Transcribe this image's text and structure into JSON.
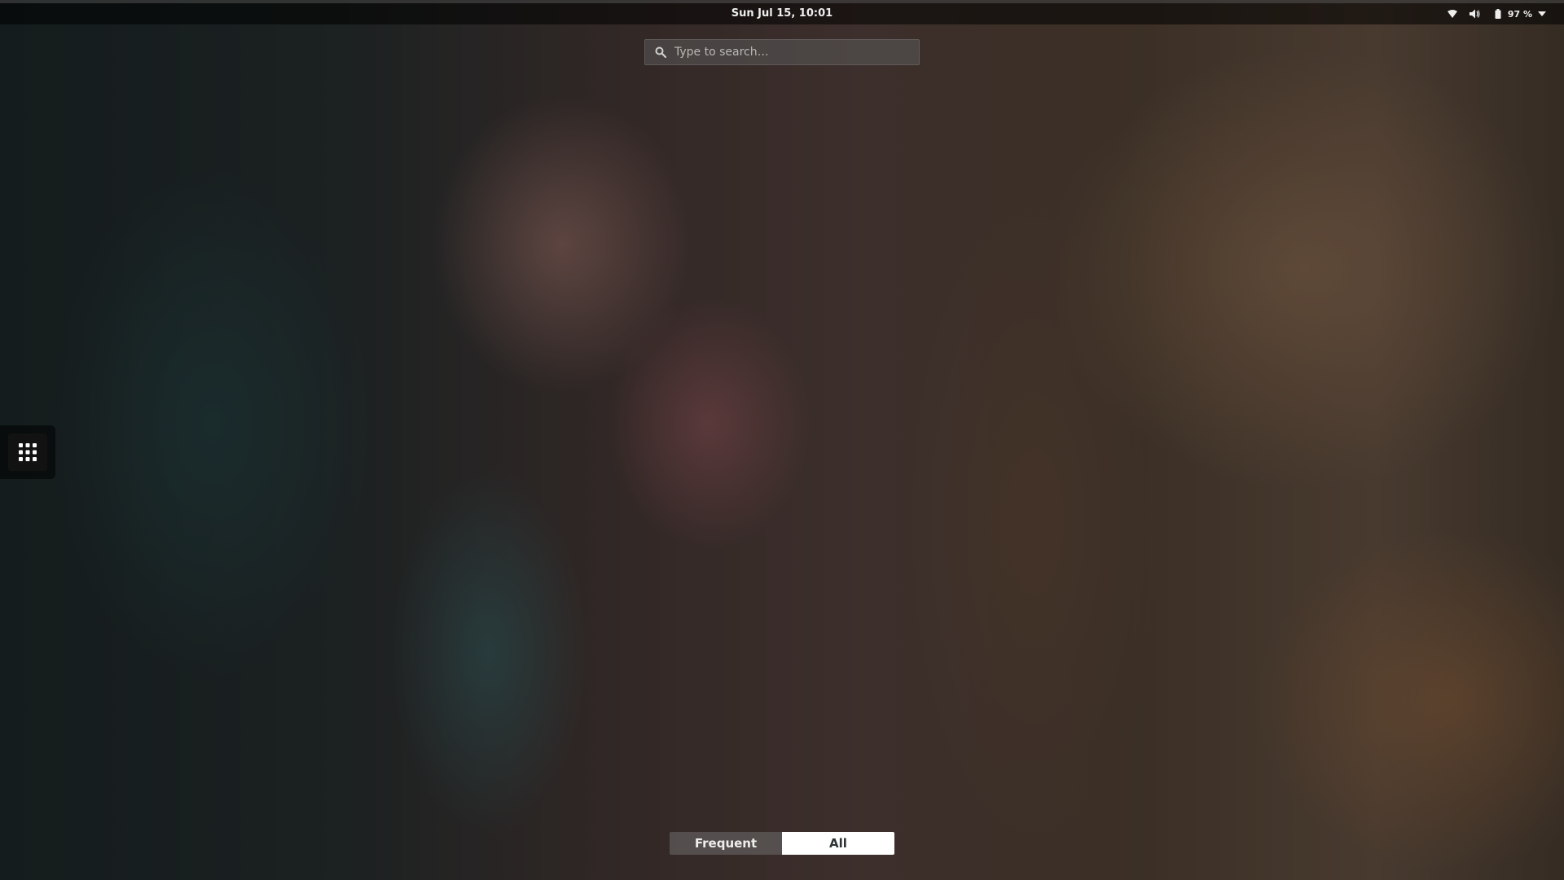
{
  "top_bar": {
    "clock": "Sun Jul 15, 10:01",
    "battery_percent": "97 %",
    "icons": [
      "wifi-icon",
      "volume-icon",
      "battery-icon",
      "dropdown-arrow-icon"
    ]
  },
  "search": {
    "placeholder": "Type to search…",
    "value": "",
    "icon": "search-icon"
  },
  "dash": {
    "show_apps_icon": "grid-icon"
  },
  "view_selector": {
    "tabs": [
      {
        "label": "Frequent",
        "selected": false
      },
      {
        "label": "All",
        "selected": true
      }
    ]
  },
  "colors": {
    "panel_text": "#eeeeec",
    "selected_tab_bg": "#ffffff",
    "selected_tab_text": "#2e3436"
  }
}
